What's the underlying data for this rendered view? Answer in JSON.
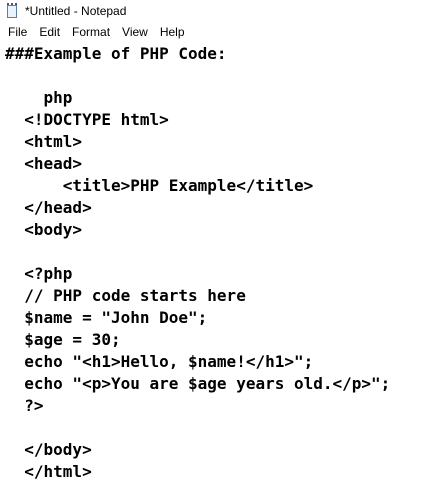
{
  "window": {
    "title": "*Untitled - Notepad",
    "icon": "notepad-icon"
  },
  "menu": {
    "items": [
      {
        "label": "File"
      },
      {
        "label": "Edit"
      },
      {
        "label": "Format"
      },
      {
        "label": "View"
      },
      {
        "label": "Help"
      }
    ]
  },
  "editor": {
    "lines": [
      "###Example of PHP Code:",
      "",
      "    php",
      "  <!DOCTYPE html>",
      "  <html>",
      "  <head>",
      "      <title>PHP Example</title>",
      "  </head>",
      "  <body>",
      "",
      "  <?php",
      "  // PHP code starts here",
      "  $name = \"John Doe\";",
      "  $age = 30;",
      "  echo \"<h1>Hello, $name!</h1>\";",
      "  echo \"<p>You are $age years old.</p>\";",
      "  ?>",
      "",
      "  </body>",
      "  </html>"
    ]
  }
}
